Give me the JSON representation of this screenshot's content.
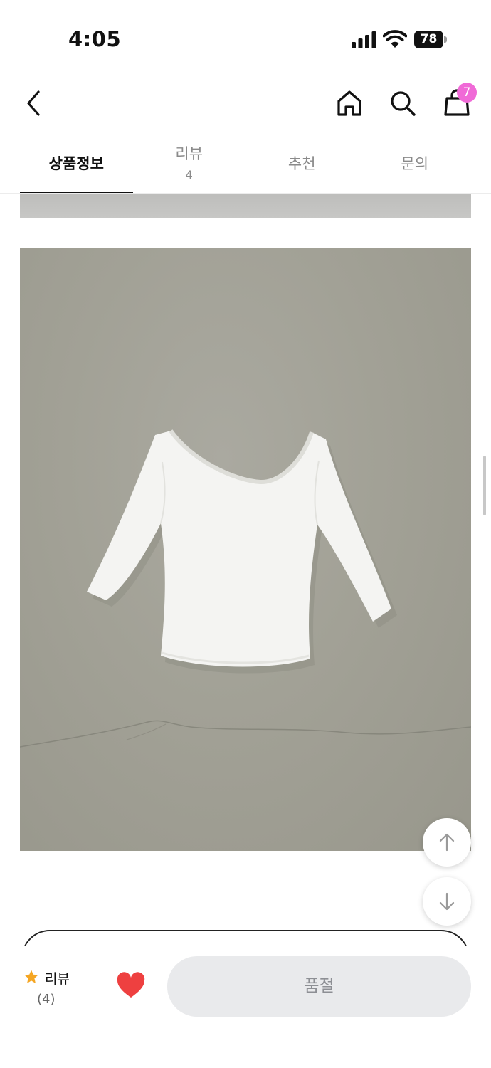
{
  "status_bar": {
    "time": "4:05",
    "battery": "78"
  },
  "header": {
    "icons": [
      "back-icon",
      "home-icon",
      "search-icon",
      "shopping-bag-icon"
    ],
    "cart_count": "7"
  },
  "tabs": [
    {
      "label": "상품정보",
      "active": true
    },
    {
      "label": "리뷰",
      "count": "4",
      "active": false
    },
    {
      "label": "추천",
      "active": false
    },
    {
      "label": "문의",
      "active": false
    }
  ],
  "floating_buttons": [
    "arrow-up-icon",
    "arrow-down-icon"
  ],
  "bottom_bar": {
    "review_label": "리뷰",
    "review_count": "(4)",
    "liked": true,
    "accent_color": "#ee4040",
    "soldout_label": "품절"
  },
  "colors": {
    "badge": "#f06ad7",
    "active_tab": "#111111",
    "star": "#f5a623",
    "soldout_bg": "#e9eaec"
  }
}
